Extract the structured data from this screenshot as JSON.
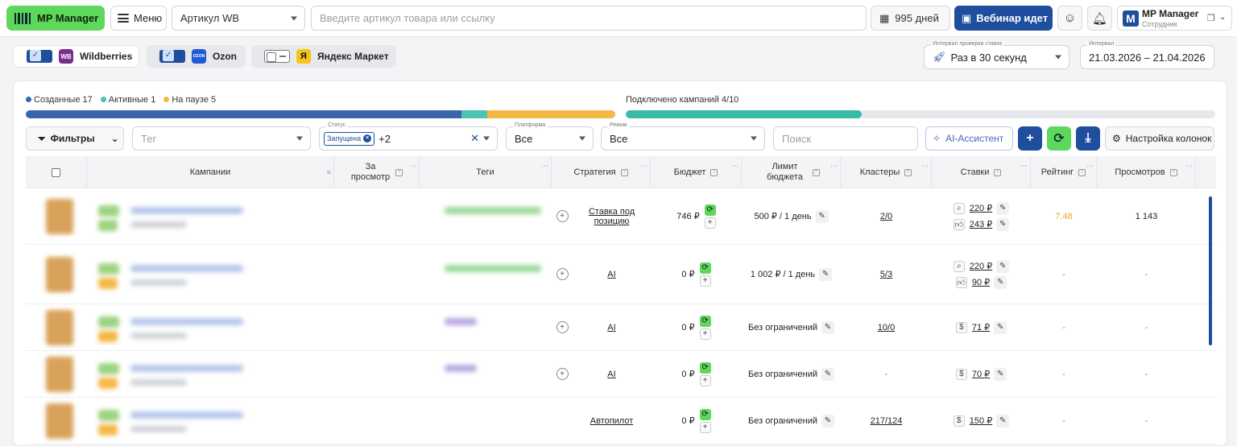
{
  "topbar": {
    "logo_label": "MP Manager",
    "menu_label": "Меню",
    "article_select": "Артикул WB",
    "search_placeholder": "Введите артикул товара или ссылку",
    "days_label": "995 дней",
    "webinar_label": "Вебинар идет",
    "user_name": "MP Manager",
    "user_role": "Сотрудник",
    "user_avatar": "M"
  },
  "marketplaces": [
    {
      "label": "Wildberries",
      "enabled": true,
      "logo_text": "WB",
      "color": "#7b2c8e"
    },
    {
      "label": "Ozon",
      "enabled": true,
      "logo_text": "OZON",
      "color": "#1f5bd6"
    },
    {
      "label": "Яндекс Маркет",
      "enabled": false,
      "logo_text": "Я",
      "color": "#f5c518"
    }
  ],
  "interval": {
    "label": "Интервал проверки ставок",
    "value": "Раз в 30 секунд"
  },
  "date_range": {
    "label": "Интервал",
    "value": "21.03.2026 – 21.04.2026"
  },
  "stats": {
    "created": "Созданные 17",
    "active": "Активные 1",
    "paused": "На паузе 5",
    "created_count": 17,
    "active_count": 1,
    "paused_count": 5,
    "connected_label": "Подключено кампаний 4/10",
    "connected_fraction": 0.4,
    "colors": {
      "created": "#3a64ad",
      "active": "#4bc3b0",
      "paused": "#f4b846"
    }
  },
  "filters": {
    "filters_label": "Фильтры",
    "tag_placeholder": "Тег",
    "status_label": "Статус",
    "status_chip": "Запущена",
    "status_more": "+2",
    "platform_label": "Платформа",
    "platform_value": "Все",
    "mode_label": "Режим",
    "mode_value": "Все",
    "search_placeholder": "Поиск",
    "ai_label": "AI-Ассистент",
    "columns_label": "Настройка колонок"
  },
  "columns": {
    "campaigns": "Кампании",
    "per_view": "За просмотр",
    "tags": "Теги",
    "strategy": "Стратегия",
    "budget": "Бюджет",
    "budget_limit": "Лимит бюджета",
    "clusters": "Кластеры",
    "bids": "Ставки",
    "rating": "Рейтинг",
    "views": "Просмотров"
  },
  "rows": [
    {
      "strategy": "Ставка под позицию",
      "budget": "746 ₽",
      "limit": "500 ₽ / 1 день",
      "clusters": "2/0",
      "bids": [
        {
          "icon": "search",
          "value": "220 ₽"
        },
        {
          "icon": "thumb",
          "value": "243 ₽"
        }
      ],
      "rating": "7.48",
      "views": "1 143"
    },
    {
      "strategy": "AI",
      "budget": "0 ₽",
      "limit": "1 002 ₽ / 1 день",
      "clusters": "5/3",
      "bids": [
        {
          "icon": "search",
          "value": "220 ₽"
        },
        {
          "icon": "thumb",
          "value": "90 ₽"
        }
      ],
      "rating": "-",
      "views": "-"
    },
    {
      "strategy": "AI",
      "budget": "0 ₽",
      "limit": "Без ограничений",
      "clusters": "10/0",
      "bids": [
        {
          "icon": "coin",
          "value": "71 ₽"
        }
      ],
      "rating": "-",
      "views": "-"
    },
    {
      "strategy": "AI",
      "budget": "0 ₽",
      "limit": "Без ограничений",
      "clusters": "-",
      "bids": [
        {
          "icon": "coin",
          "value": "70 ₽"
        }
      ],
      "rating": "-",
      "views": "-"
    },
    {
      "strategy": "Автопилот",
      "budget": "0 ₽",
      "limit": "Без ограничений",
      "clusters": "217/124",
      "bids": [
        {
          "icon": "coin",
          "value": "150 ₽"
        }
      ],
      "rating": "-",
      "views": "-"
    }
  ]
}
